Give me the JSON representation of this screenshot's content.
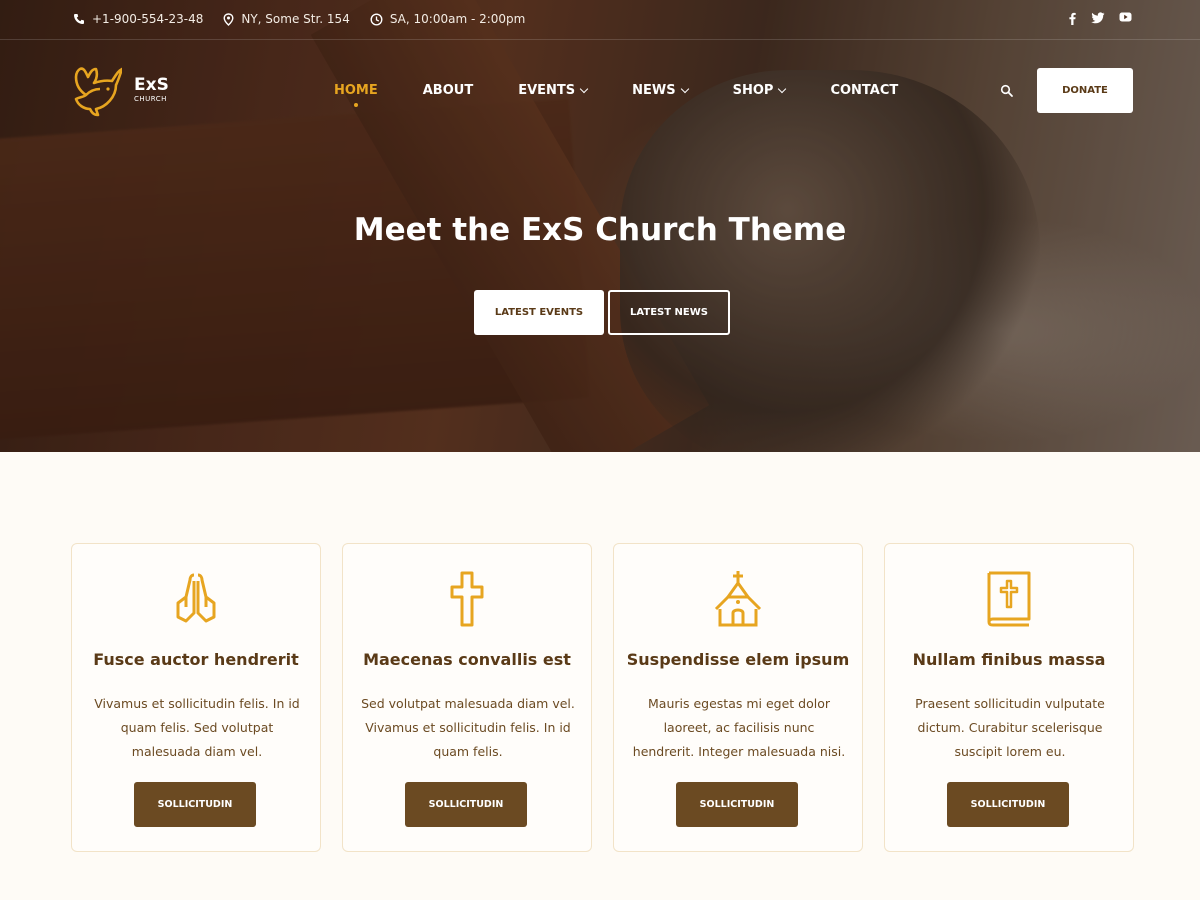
{
  "topbar": {
    "phone": "+1-900-554-23-48",
    "address": "NY, Some Str. 154",
    "hours": "SA, 10:00am - 2:00pm",
    "social": [
      "f",
      "t",
      "yt"
    ]
  },
  "logo": {
    "title": "ExS",
    "subtitle": "CHURCH"
  },
  "nav": {
    "items": [
      {
        "label": "HOME",
        "active": true,
        "dropdown": false
      },
      {
        "label": "ABOUT",
        "dropdown": false
      },
      {
        "label": "EVENTS",
        "dropdown": true
      },
      {
        "label": "NEWS",
        "dropdown": true
      },
      {
        "label": "SHOP",
        "dropdown": true
      },
      {
        "label": "CONTACT",
        "dropdown": false
      }
    ],
    "donate_label": "DONATE"
  },
  "hero": {
    "title": "Meet the ExS Church Theme",
    "btn_events": "LATEST EVENTS",
    "btn_news": "LATEST NEWS"
  },
  "features": [
    {
      "icon": "praying-hands-icon",
      "title": "Fusce auctor hendrerit",
      "text": "Vivamus et sollicitudin felis. In id quam felis. Sed volutpat malesuada diam vel.",
      "button": "SOLLICITUDIN"
    },
    {
      "icon": "cross-icon",
      "title": "Maecenas convallis est",
      "text": "Sed volutpat malesuada diam vel. Vivamus et sollicitudin felis. In id quam felis.",
      "button": "SOLLICITUDIN"
    },
    {
      "icon": "church-icon",
      "title": "Suspendisse elem ipsum",
      "text": "Mauris egestas mi eget dolor laoreet, ac facilisis nunc hendrerit. Integer malesuada nisi.",
      "button": "SOLLICITUDIN"
    },
    {
      "icon": "bible-icon",
      "title": "Nullam finibus massa",
      "text": "Praesent sollicitudin vulputate dictum. Curabitur scelerisque suscipit lorem eu.",
      "button": "SOLLICITUDIN"
    }
  ],
  "colors": {
    "accent": "#e7a520",
    "brown": "#6b4a22",
    "background": "#fefbf6"
  }
}
